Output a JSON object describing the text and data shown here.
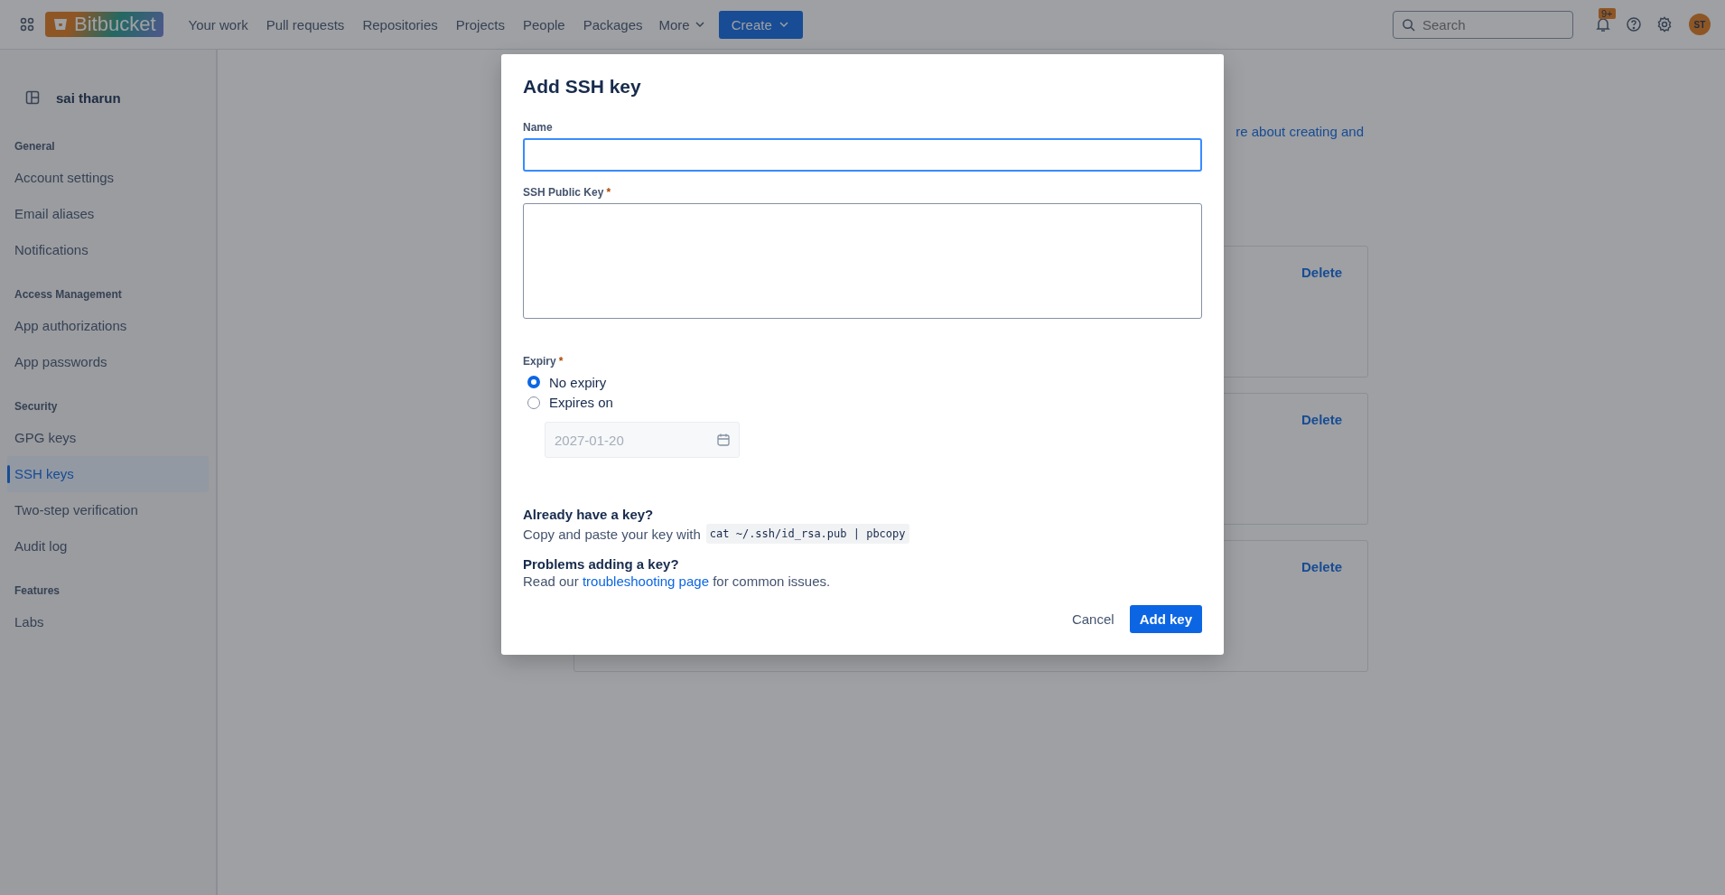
{
  "topbar": {
    "brand": "Bitbucket",
    "links": [
      "Your work",
      "Pull requests",
      "Repositories",
      "Projects",
      "People",
      "Packages"
    ],
    "more": "More",
    "create": "Create",
    "search": {
      "placeholder": "Search"
    },
    "notification_badge": "9+",
    "avatar": "ST"
  },
  "sidebar": {
    "workspace": "sai tharun",
    "sections": [
      {
        "heading": "General",
        "items": [
          {
            "label": "Account settings",
            "selected": false
          },
          {
            "label": "Email aliases",
            "selected": false
          },
          {
            "label": "Notifications",
            "selected": false
          }
        ]
      },
      {
        "heading": "Access Management",
        "items": [
          {
            "label": "App authorizations",
            "selected": false
          },
          {
            "label": "App passwords",
            "selected": false
          }
        ]
      },
      {
        "heading": "Security",
        "items": [
          {
            "label": "GPG keys",
            "selected": false
          },
          {
            "label": "SSH keys",
            "selected": true
          },
          {
            "label": "Two-step verification",
            "selected": false
          },
          {
            "label": "Audit log",
            "selected": false
          }
        ]
      },
      {
        "heading": "Features",
        "items": [
          {
            "label": "Labs",
            "selected": false
          }
        ]
      }
    ]
  },
  "main": {
    "intro_fragment": "re about creating and",
    "cards": [
      {
        "action": "Delete"
      },
      {
        "action": "Delete"
      },
      {
        "action": "Delete"
      }
    ]
  },
  "dialog": {
    "title": "Add SSH key",
    "required_marker": "*",
    "name_field": {
      "label": "Name",
      "required": false,
      "focused": true
    },
    "key_field": {
      "label": "SSH Public Key",
      "required": true,
      "focused": false
    },
    "expiry": {
      "label": "Expiry",
      "required": true,
      "options": [
        {
          "label": "No expiry",
          "selected": true
        },
        {
          "label": "Expires on",
          "selected": false
        }
      ],
      "date_field": {
        "value": "2027-01-20",
        "disabled": true
      }
    },
    "help": [
      {
        "heading": "Already have a key?",
        "text": "Copy and paste your key with",
        "code": "cat ~/.ssh/id_rsa.pub | pbcopy"
      },
      {
        "heading": "Problems adding a key?",
        "before": "Read our ",
        "link": "troubleshooting page",
        "after": " for common issues."
      }
    ],
    "buttons": [
      {
        "label": "Cancel",
        "kind": "subtle"
      },
      {
        "label": "Add key",
        "kind": "primary"
      }
    ]
  }
}
